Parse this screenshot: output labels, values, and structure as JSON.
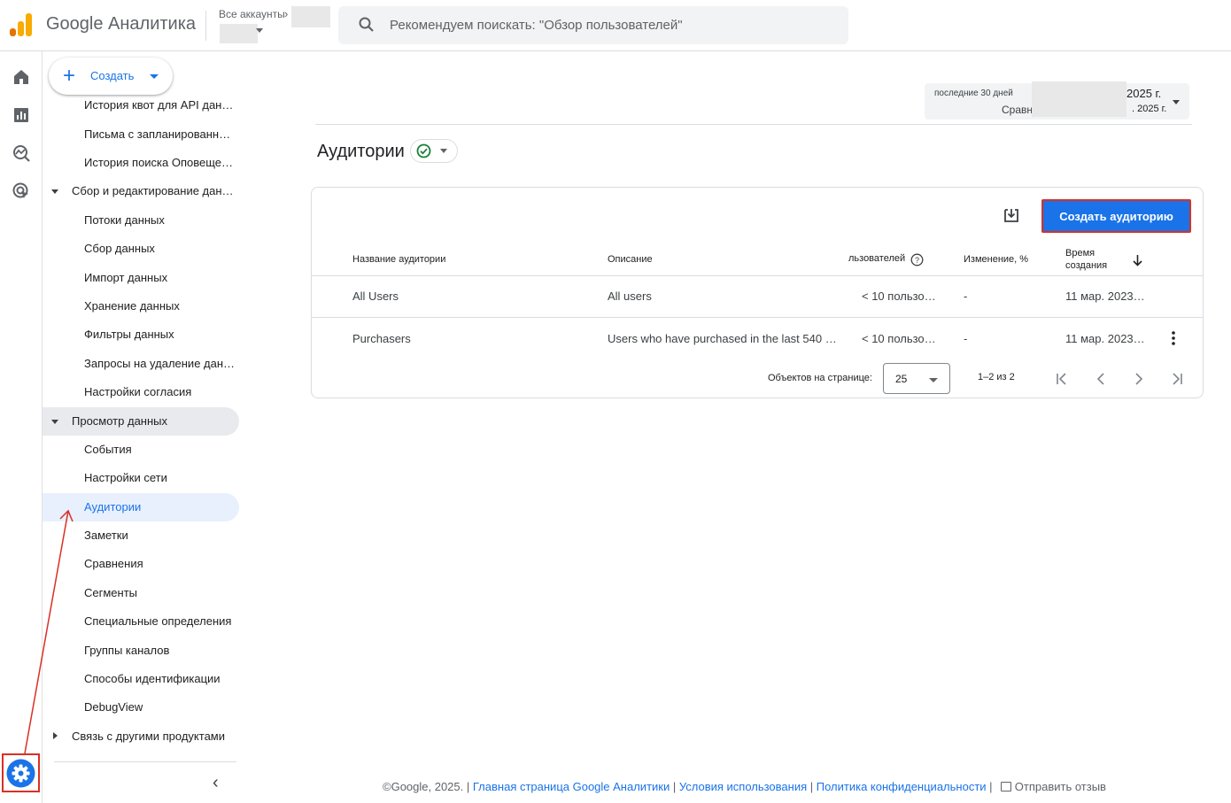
{
  "app": {
    "title": "Google Аналитика"
  },
  "account": {
    "label": "Все аккаунты"
  },
  "search": {
    "placeholder": "Рекомендуем поискать: \"Обзор пользователей\""
  },
  "rail": {
    "icons": [
      "home-icon",
      "reports-icon",
      "explore-icon",
      "advertising-icon",
      "admin-gear-icon"
    ]
  },
  "sidebar": {
    "create_label": "Создать",
    "items": [
      {
        "label": "История квот для API дан…",
        "level": 2
      },
      {
        "label": "Письма с запланированно…",
        "level": 2
      },
      {
        "label": "История поиска Оповеще…",
        "level": 2
      },
      {
        "label": "Сбор и редактирование дан…",
        "level": 1,
        "expanded": true
      },
      {
        "label": "Потоки данных",
        "level": 2
      },
      {
        "label": "Сбор данных",
        "level": 2
      },
      {
        "label": "Импорт данных",
        "level": 2
      },
      {
        "label": "Хранение данных",
        "level": 2
      },
      {
        "label": "Фильтры данных",
        "level": 2
      },
      {
        "label": "Запросы на удаление дан…",
        "level": 2
      },
      {
        "label": "Настройки согласия",
        "level": 2
      },
      {
        "label": "Просмотр данных",
        "level": 1,
        "expanded": true
      },
      {
        "label": "События",
        "level": 2
      },
      {
        "label": "Настройки сети",
        "level": 2
      },
      {
        "label": "Аудитории",
        "level": 2,
        "active": true
      },
      {
        "label": "Заметки",
        "level": 2
      },
      {
        "label": "Сравнения",
        "level": 2
      },
      {
        "label": "Сегменты",
        "level": 2
      },
      {
        "label": "Специальные определения",
        "level": 2
      },
      {
        "label": "Группы каналов",
        "level": 2
      },
      {
        "label": "Способы идентификации",
        "level": 2
      },
      {
        "label": "DebugView",
        "level": 2
      },
      {
        "label": "Связь с другими продуктами",
        "level": 1,
        "expanded": false
      }
    ]
  },
  "date_range": {
    "label": "последние 30 дней",
    "compare_label": "Сравн",
    "end_year": "2025 г.",
    "compare_end_year": ". 2025 г."
  },
  "page": {
    "title": "Аудитории"
  },
  "audiences": {
    "create_button": "Создать аудиторию",
    "columns": [
      "Название аудитории",
      "Описание",
      "льзователей",
      "Изменение, %",
      "Время создания"
    ],
    "time_col_line1": "Время",
    "time_col_line2": "создания",
    "rows": [
      {
        "name": "All Users",
        "description": "All users",
        "users": "< 10 пользо…",
        "change": "-",
        "created": "11 мар. 2023…"
      },
      {
        "name": "Purchasers",
        "description": "Users who have purchased in the last 540 d…",
        "users": "< 10 пользо…",
        "change": "-",
        "created": "11 мар. 2023…"
      }
    ],
    "pagination": {
      "per_page_label": "Объектов на странице:",
      "per_page_value": "25",
      "range": "1–2 из 2"
    }
  },
  "footer": {
    "copyright": "©Google, 2025. |",
    "link_home": "Главная страница Google Аналитики",
    "link_terms": "Условия использования",
    "link_privacy": "Политика конфиденциальности",
    "feedback": "Отправить отзыв"
  },
  "colors": {
    "accent": "#1a73e8",
    "annotation": "#d93025",
    "active_bg": "#e8f0fe"
  }
}
